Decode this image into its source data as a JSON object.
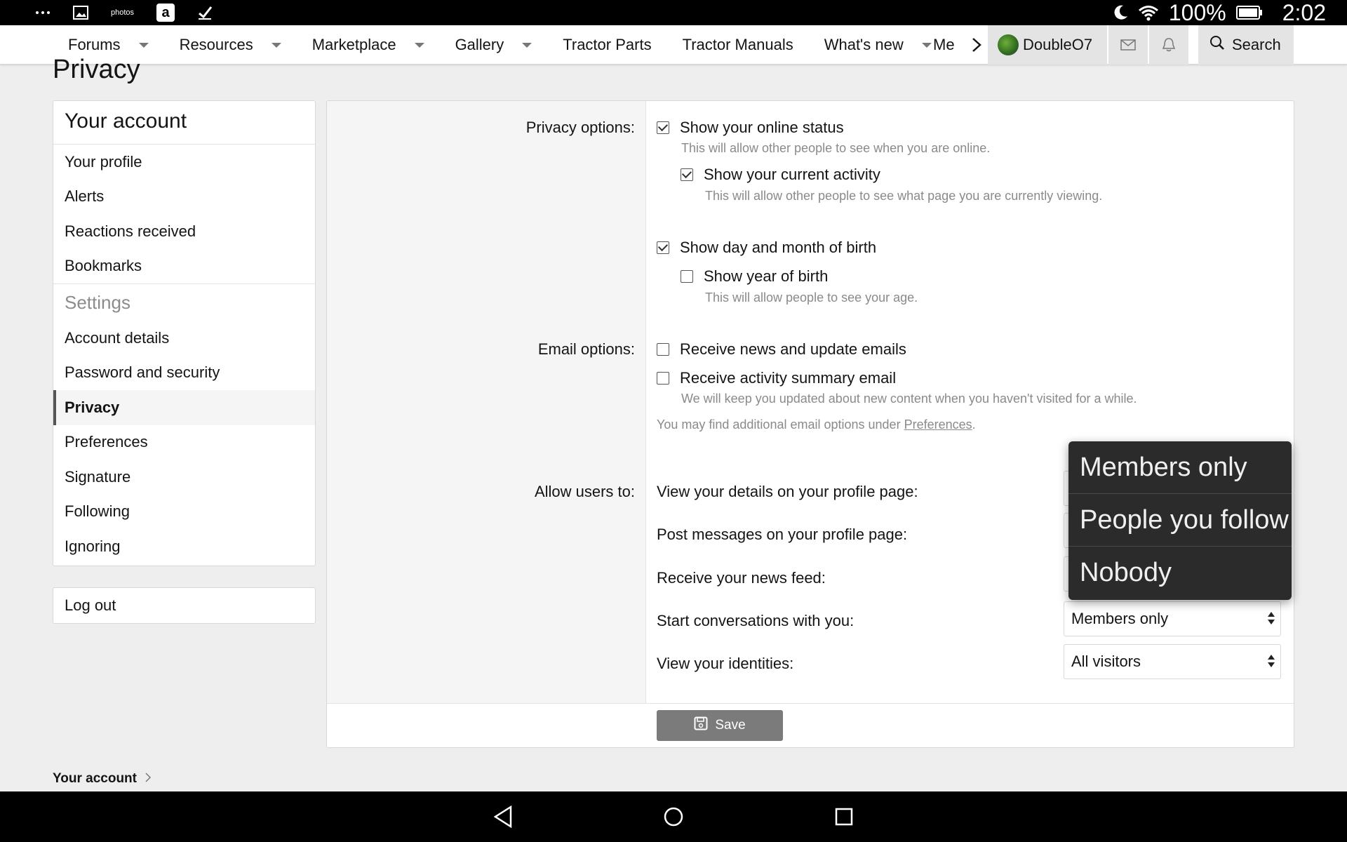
{
  "status_bar": {
    "battery": "100%",
    "time": "2:02",
    "icons": [
      "more-icon",
      "gallery-icon",
      "photos-icon",
      "amazon-icon",
      "check-icon",
      "moon-icon",
      "wifi-icon",
      "battery-icon"
    ],
    "photos_label": "photos",
    "amazon_letter": "a"
  },
  "nav": {
    "items": [
      {
        "label": "Forums",
        "has_caret": true
      },
      {
        "label": "Resources",
        "has_caret": true
      },
      {
        "label": "Marketplace",
        "has_caret": true
      },
      {
        "label": "Gallery",
        "has_caret": true
      },
      {
        "label": "Tractor Parts",
        "has_caret": false
      },
      {
        "label": "Tractor Manuals",
        "has_caret": false
      },
      {
        "label": "What's new",
        "has_caret": true
      }
    ],
    "more_label": "Me",
    "username": "DoubleO7",
    "search_label": "Search"
  },
  "page_title": "Privacy",
  "sidebar": {
    "header": "Your account",
    "items": [
      "Your profile",
      "Alerts",
      "Reactions received",
      "Bookmarks"
    ],
    "settings_header": "Settings",
    "settings_items": [
      "Account details",
      "Password and security",
      "Privacy",
      "Preferences",
      "Signature",
      "Following",
      "Ignoring"
    ],
    "active_item": "Privacy",
    "logout": "Log out"
  },
  "form": {
    "privacy_label": "Privacy options:",
    "privacy_options": [
      {
        "label": "Show your online status",
        "checked": true,
        "hint": "This will allow other people to see when you are online."
      },
      {
        "label": "Show your current activity",
        "checked": true,
        "hint": "This will allow other people to see what page you are currently viewing."
      },
      {
        "label": "Show day and month of birth",
        "checked": true,
        "hint": ""
      },
      {
        "label": "Show year of birth",
        "checked": false,
        "hint": "This will allow people to see your age."
      }
    ],
    "email_label": "Email options:",
    "email_options": [
      {
        "label": "Receive news and update emails",
        "checked": false
      },
      {
        "label": "Receive activity summary email",
        "checked": false,
        "hint": "We will keep you updated about new content when you haven't visited for a while."
      }
    ],
    "email_note_prefix": "You may find additional email options under ",
    "email_note_link": "Preferences",
    "email_note_suffix": ".",
    "allow_label": "Allow users to:",
    "allow_rows": [
      {
        "label": "View your details on your profile page:",
        "value": ""
      },
      {
        "label": "Post messages on your profile page:",
        "value": ""
      },
      {
        "label": "Receive your news feed:",
        "value": ""
      },
      {
        "label": "Start conversations with you:",
        "value": "Members only"
      },
      {
        "label": "View your identities:",
        "value": "All visitors"
      }
    ],
    "save_label": "Save"
  },
  "dropdown_popup": {
    "options": [
      "Members only",
      "People you follow",
      "Nobody"
    ]
  },
  "breadcrumb": "Your account"
}
